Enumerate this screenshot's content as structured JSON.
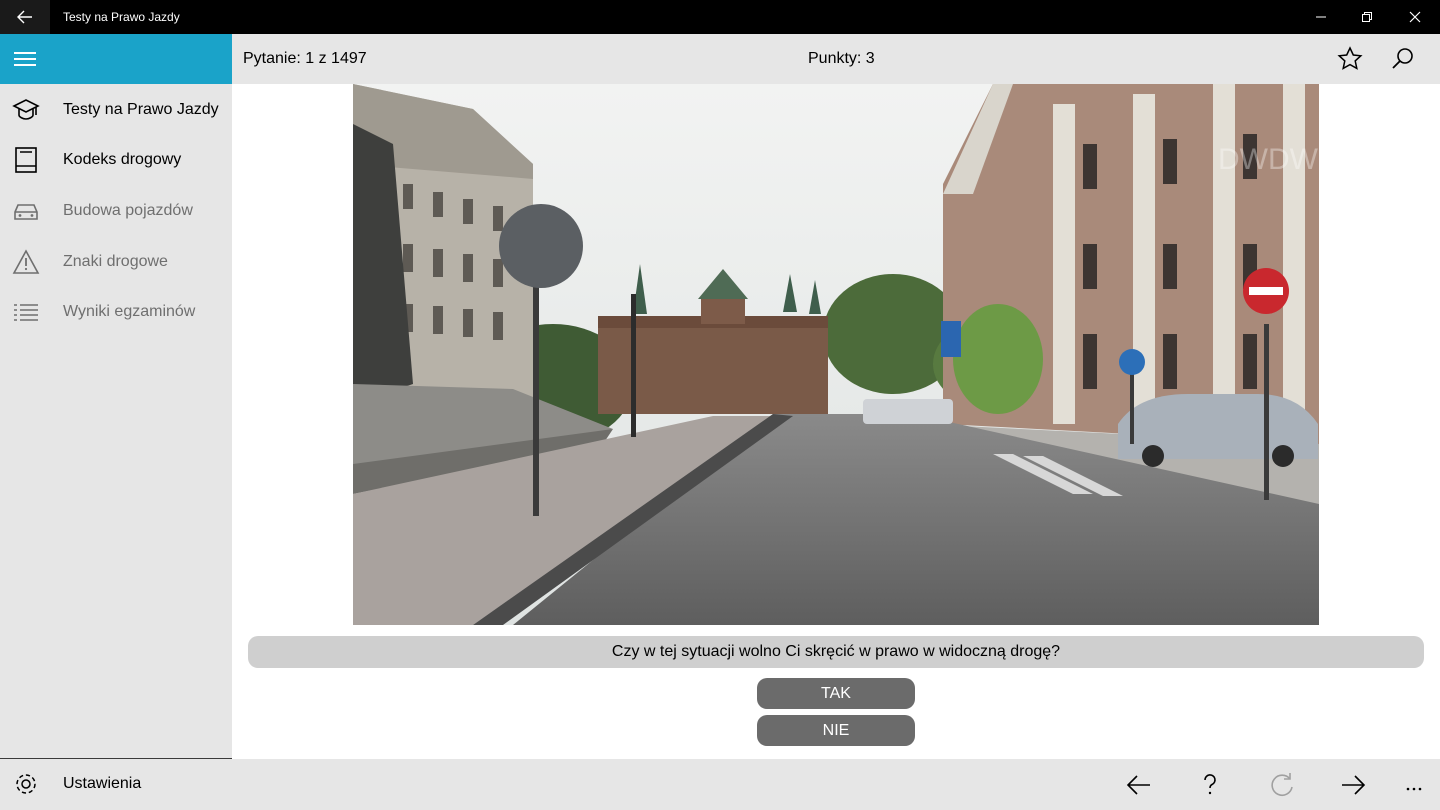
{
  "window": {
    "title": "Testy na Prawo Jazdy"
  },
  "sidebar": {
    "items": [
      {
        "label": "Testy na Prawo Jazdy",
        "icon": "graduation-cap-icon"
      },
      {
        "label": "Kodeks drogowy",
        "icon": "book-icon"
      },
      {
        "label": "Budowa pojazdów",
        "icon": "car-icon"
      },
      {
        "label": "Znaki drogowe",
        "icon": "warning-triangle-icon"
      },
      {
        "label": "Wyniki egzaminów",
        "icon": "list-icon"
      }
    ],
    "settings_label": "Ustawienia"
  },
  "header": {
    "question_counter": "Pytanie: 1 z 1497",
    "points": "Punkty: 3"
  },
  "photo": {
    "watermark": "DWDW"
  },
  "question": {
    "text": "Czy w tej sytuacji wolno Ci skręcić w prawo w widoczną drogę?"
  },
  "answers": {
    "yes": "TAK",
    "no": "NIE"
  },
  "colors": {
    "accent": "#1aa3c9",
    "titlebar": "#000000",
    "button": "#6b6b6b",
    "panel": "#e6e6e6"
  }
}
